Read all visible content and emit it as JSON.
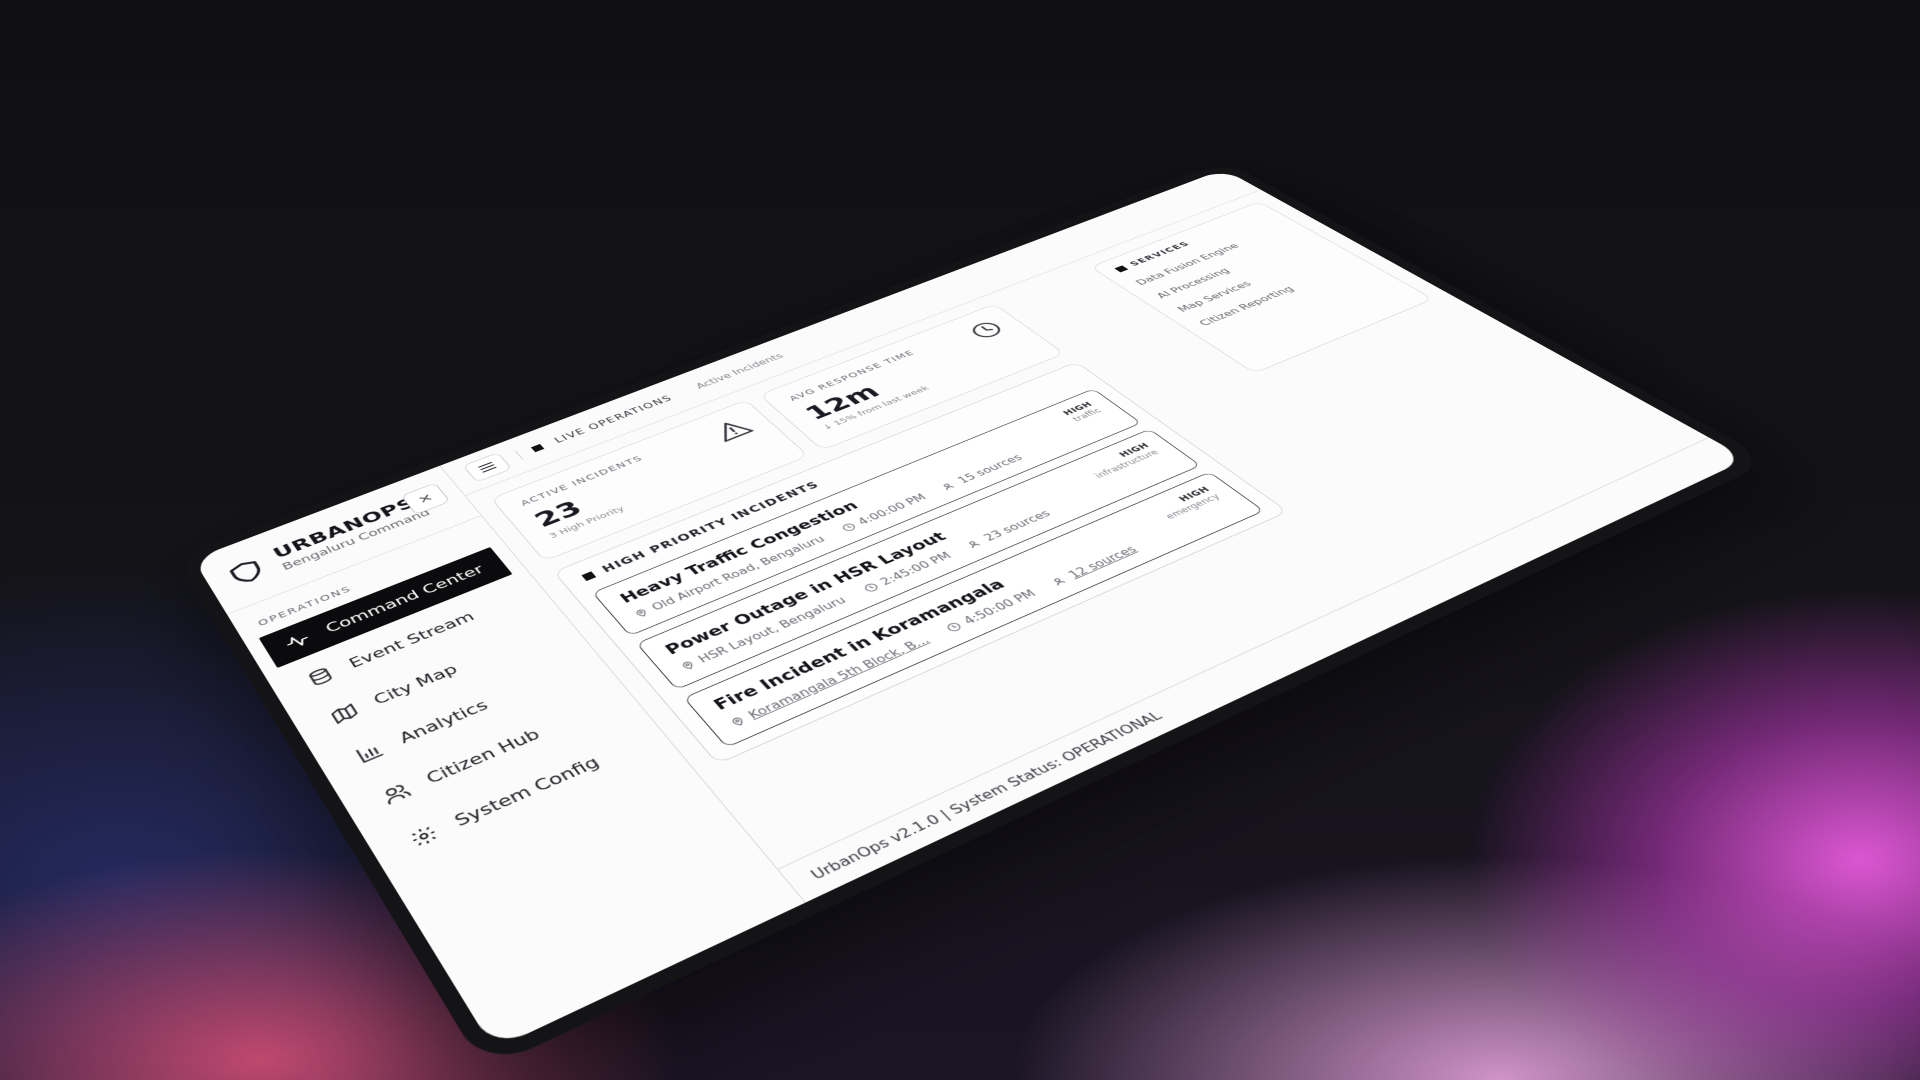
{
  "brand": {
    "title": "URBANOPS",
    "subtitle": "Bengaluru Command",
    "icon": "shield-icon"
  },
  "nav": {
    "heading": "OPERATIONS",
    "items": [
      {
        "label": "Command Center",
        "icon": "activity-icon",
        "active": true
      },
      {
        "label": "Event Stream",
        "icon": "database-icon"
      },
      {
        "label": "City Map",
        "icon": "map-icon"
      },
      {
        "label": "Analytics",
        "icon": "bar-chart-icon"
      },
      {
        "label": "Citizen Hub",
        "icon": "users-icon"
      },
      {
        "label": "System Config",
        "icon": "gear-icon"
      }
    ]
  },
  "topbar": {
    "live_label": "LIVE OPERATIONS",
    "live_sub": "Active Incidents"
  },
  "cards": [
    {
      "label": "ACTIVE INCIDENTS",
      "value": "23",
      "sub": "3 High Priority",
      "icon": "alert-triangle-icon"
    },
    {
      "label": "AVG RESPONSE TIME",
      "value": "12m",
      "sub": "↓ 15% from last week",
      "icon": "clock-icon"
    }
  ],
  "side_panel": {
    "title": "SERVICES",
    "items": [
      "Data Fusion Engine",
      "AI Processing",
      "Map Services",
      "Citizen Reporting"
    ]
  },
  "incidents": {
    "heading": "HIGH PRIORITY INCIDENTS",
    "items": [
      {
        "title": "Heavy Traffic Congestion",
        "location": "Old Airport Road, Bengaluru",
        "time": "4:00:00 PM",
        "sources": "15 sources",
        "priority": "HIGH",
        "category": "traffic"
      },
      {
        "title": "Power Outage in HSR Layout",
        "location": "HSR Layout, Bengaluru",
        "time": "2:45:00 PM",
        "sources": "23 sources",
        "priority": "HIGH",
        "category": "infrastructure"
      },
      {
        "title": "Fire Incident in Koramangala",
        "location": "Koramangala 5th Block, B...",
        "time": "4:50:00 PM",
        "sources": "12 sources",
        "priority": "HIGH",
        "category": "emergency"
      }
    ]
  },
  "footer": {
    "text": "UrbanOps v2.1.0 | System Status: OPERATIONAL"
  }
}
